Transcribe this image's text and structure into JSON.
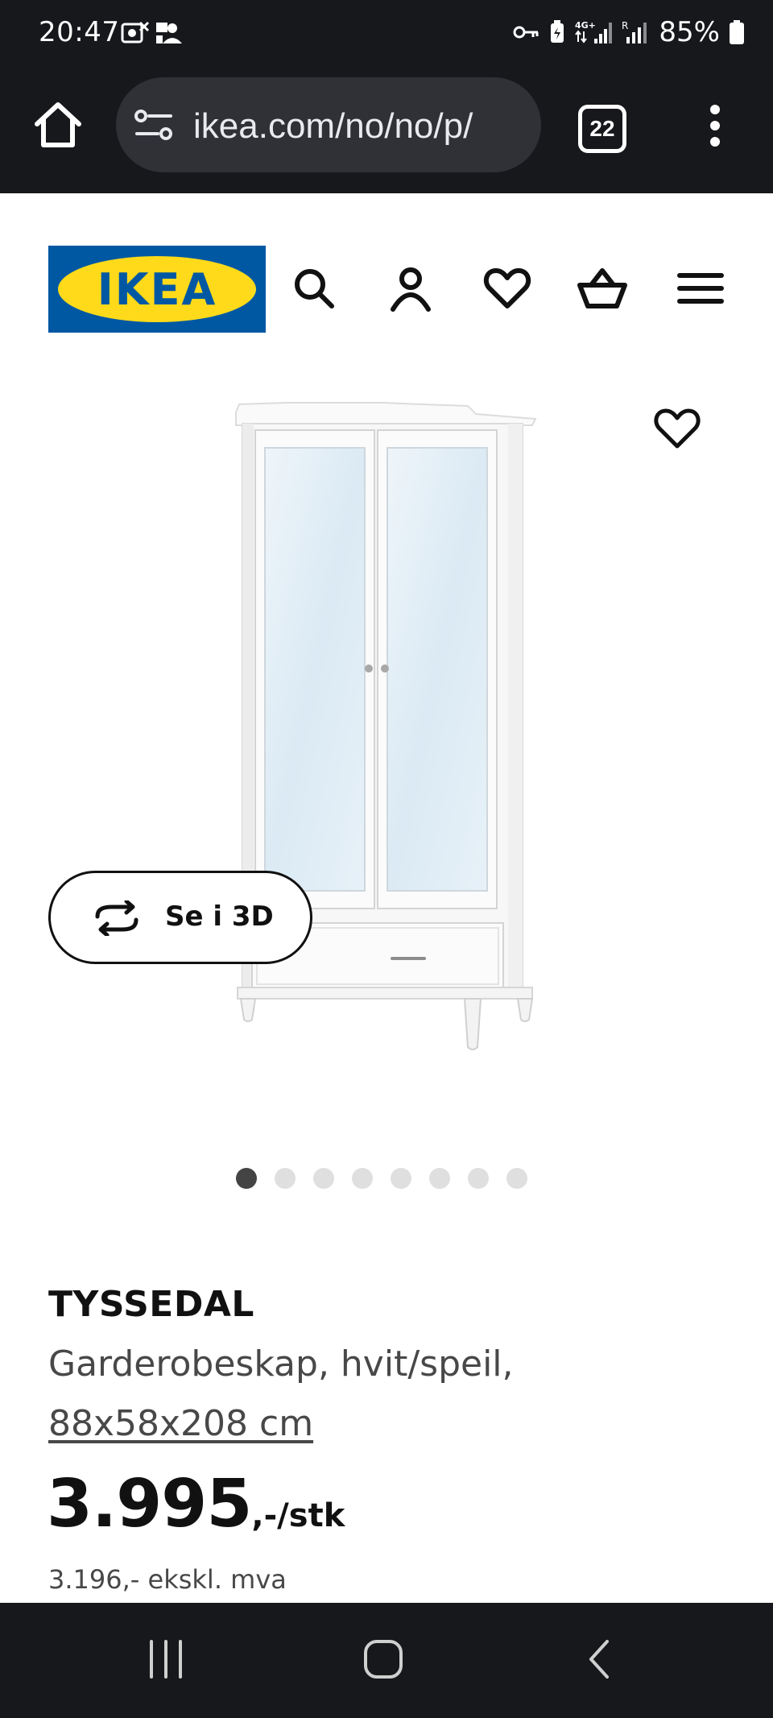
{
  "status_bar": {
    "time": "20:47",
    "network": "4G+",
    "battery": "85%",
    "icons": [
      "notification-icon",
      "contacts-icon",
      "vpn-key-icon",
      "battery-saver-icon",
      "signal-icon",
      "roaming-signal-icon",
      "battery-icon"
    ]
  },
  "browser": {
    "url": "ikea.com/no/no/p/",
    "tab_count": "22",
    "icons": [
      "home-icon",
      "site-settings-icon",
      "tab-switcher-icon",
      "more-icon"
    ]
  },
  "header": {
    "logo_text": "IKEA",
    "icons": [
      "search-icon",
      "account-icon",
      "favorites-icon",
      "cart-icon",
      "menu-icon"
    ]
  },
  "gallery": {
    "view_3d_label": "Se i 3D",
    "image_count": 8,
    "active_index": 0
  },
  "product": {
    "name": "TYSSEDAL",
    "description": "Garderobeskap, hvit/speil,",
    "size": "88x58x208 cm",
    "price_main": "3.995",
    "price_unit": ",-/stk",
    "price_ex_vat": "3.196,- ekskl. mva"
  },
  "colors": {
    "ikea_blue": "#0058a3",
    "ikea_yellow": "#ffda1a",
    "system_bar": "#17181c"
  },
  "nav_bar": {
    "icons": [
      "recent-apps-icon",
      "home-nav-icon",
      "back-icon"
    ]
  }
}
